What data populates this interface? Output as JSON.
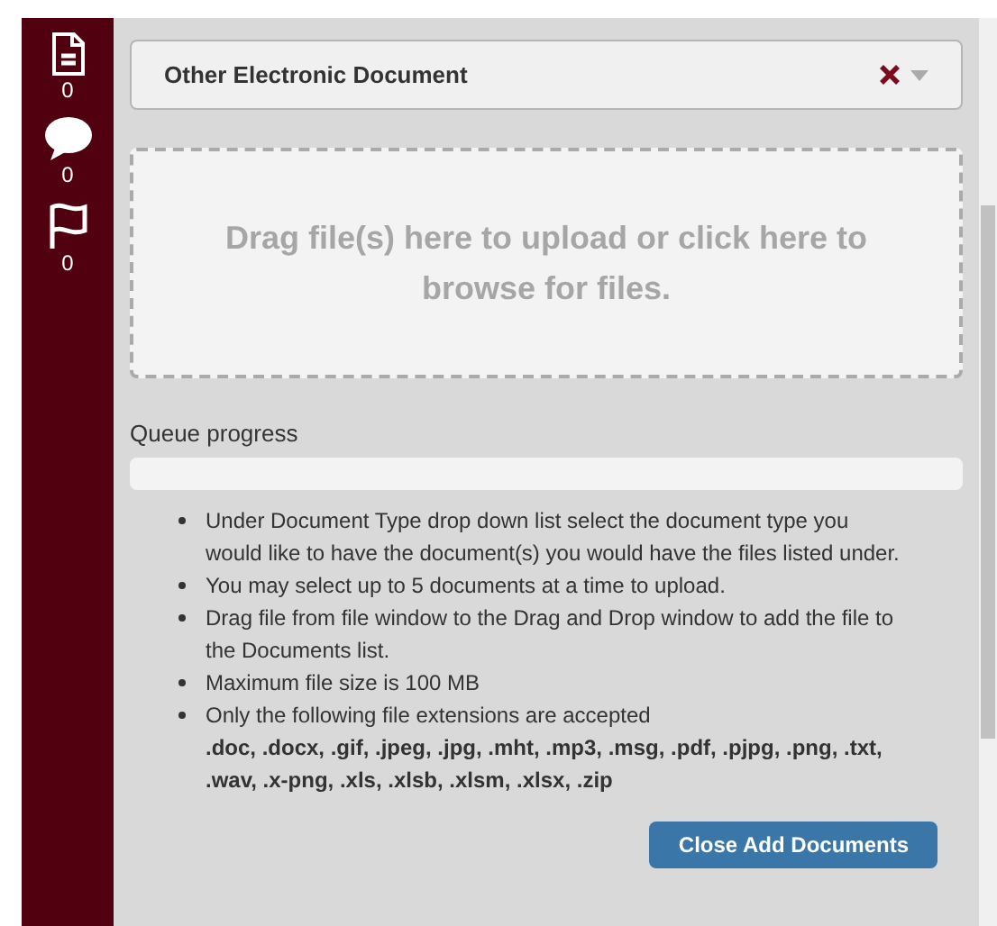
{
  "sidebar": {
    "items": [
      {
        "kind": "document",
        "count": "0"
      },
      {
        "kind": "comment",
        "count": "0"
      },
      {
        "kind": "flag",
        "count": "0"
      }
    ]
  },
  "document_type": {
    "value": "Other Electronic Document",
    "clearable": true
  },
  "dropzone": {
    "text": "Drag file(s) here to upload or click here to browse for files."
  },
  "queue": {
    "label": "Queue progress",
    "level": 0
  },
  "instructions": [
    {
      "text": "Under Document Type drop down list select the document type you would like to have the document(s) you would have the files listed under."
    },
    {
      "text": "You may select up to 5 documents at a time to upload."
    },
    {
      "text": "Drag file from file window to the Drag and Drop window to add the file to the Documents list."
    },
    {
      "text": "Maximum file size is 100 MB"
    },
    {
      "text": "Only the following file extensions are accepted",
      "detail": ".doc, .docx, .gif, .jpeg, .jpg, .mht, .mp3, .msg, .pdf, .pjpg, .png, .txt, .wav, .x-png, .xls, .xlsb, .xlsm, .xlsx, .zip"
    }
  ],
  "close_button": "Close Add Documents"
}
